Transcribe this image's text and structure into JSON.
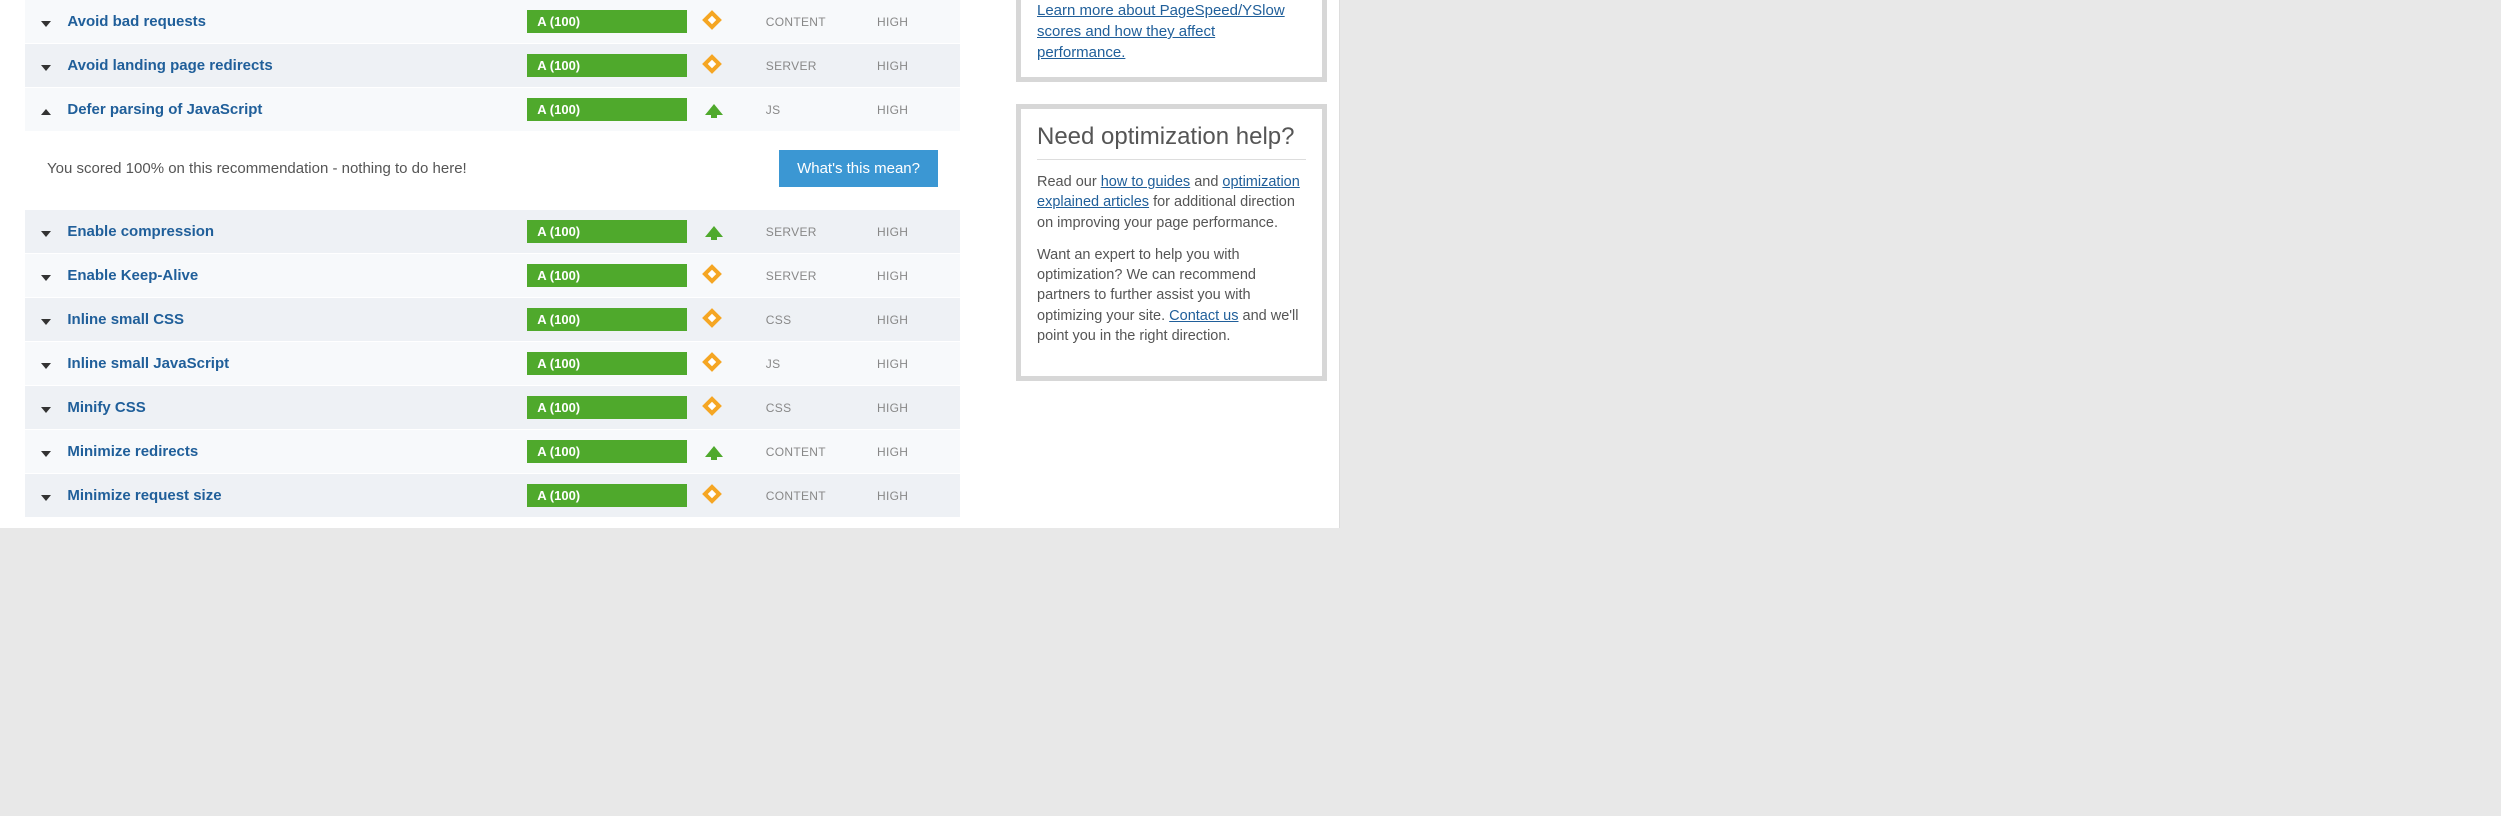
{
  "rules": [
    {
      "name": "Avoid bad requests",
      "grade": "A (100)",
      "icon": "diamond",
      "type": "CONTENT",
      "impact": "HIGH",
      "expanded": false,
      "row": "even",
      "toggle": "down"
    },
    {
      "name": "Avoid landing page redirects",
      "grade": "A (100)",
      "icon": "diamond",
      "type": "SERVER",
      "impact": "HIGH",
      "expanded": false,
      "row": "odd",
      "toggle": "down"
    },
    {
      "name": "Defer parsing of JavaScript",
      "grade": "A (100)",
      "icon": "arrow",
      "type": "JS",
      "impact": "HIGH",
      "expanded": true,
      "row": "even",
      "toggle": "up"
    },
    {
      "name": "Enable compression",
      "grade": "A (100)",
      "icon": "arrow",
      "type": "SERVER",
      "impact": "HIGH",
      "expanded": false,
      "row": "odd",
      "toggle": "down"
    },
    {
      "name": "Enable Keep-Alive",
      "grade": "A (100)",
      "icon": "diamond",
      "type": "SERVER",
      "impact": "HIGH",
      "expanded": false,
      "row": "even",
      "toggle": "down"
    },
    {
      "name": "Inline small CSS",
      "grade": "A (100)",
      "icon": "diamond",
      "type": "CSS",
      "impact": "HIGH",
      "expanded": false,
      "row": "odd",
      "toggle": "down"
    },
    {
      "name": "Inline small JavaScript",
      "grade": "A (100)",
      "icon": "diamond",
      "type": "JS",
      "impact": "HIGH",
      "expanded": false,
      "row": "even",
      "toggle": "down"
    },
    {
      "name": "Minify CSS",
      "grade": "A (100)",
      "icon": "diamond",
      "type": "CSS",
      "impact": "HIGH",
      "expanded": false,
      "row": "odd",
      "toggle": "down"
    },
    {
      "name": "Minimize redirects",
      "grade": "A (100)",
      "icon": "arrow",
      "type": "CONTENT",
      "impact": "HIGH",
      "expanded": false,
      "row": "even",
      "toggle": "down"
    },
    {
      "name": "Minimize request size",
      "grade": "A (100)",
      "icon": "diamond",
      "type": "CONTENT",
      "impact": "HIGH",
      "expanded": false,
      "row": "odd",
      "toggle": "down"
    }
  ],
  "expanded_panel": {
    "text": "You scored 100% on this recommendation - nothing to do here!",
    "button": "What's this mean?"
  },
  "sidebar": {
    "top_link": "Learn more about PageSpeed/YSlow scores and how they affect performance.",
    "help_box": {
      "title": "Need optimization help?",
      "p1_pre": "Read our ",
      "p1_link1": "how to guides",
      "p1_mid": " and ",
      "p1_link2": "optimization explained articles",
      "p1_post": " for additional direction on improving your page performance.",
      "p2_pre": "Want an expert to help you with optimization? We can recommend partners to further assist you with optimizing your site. ",
      "p2_link": "Contact us",
      "p2_post": " and we'll point you in the right direction."
    }
  }
}
